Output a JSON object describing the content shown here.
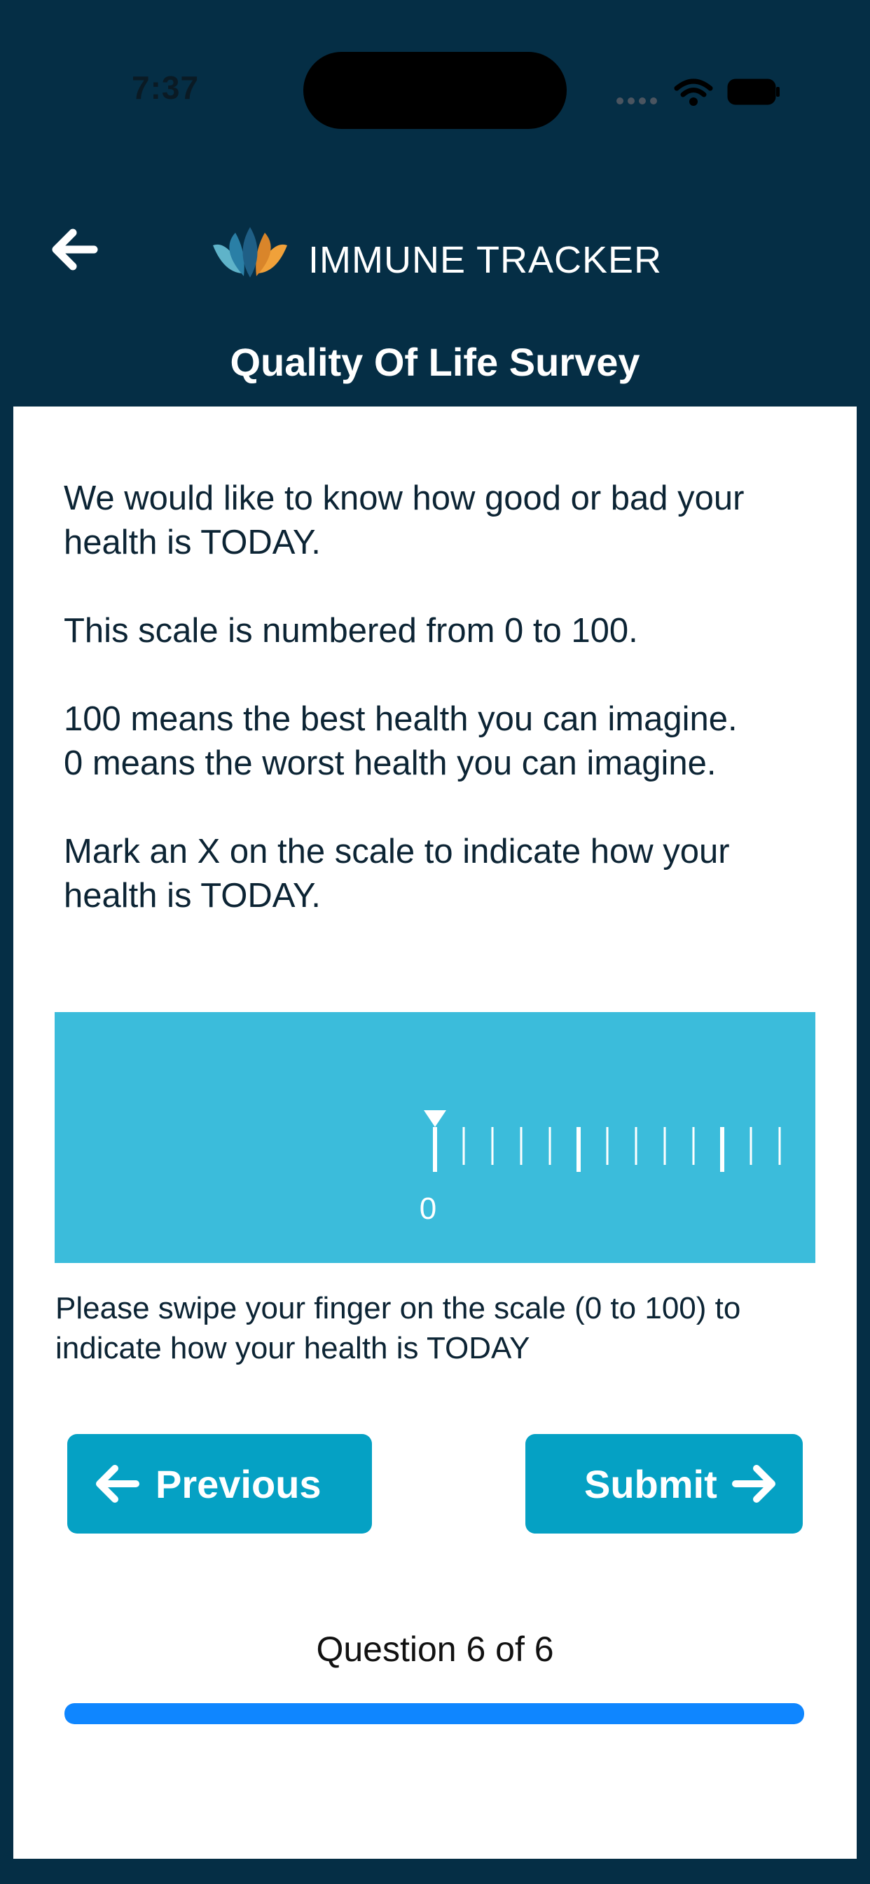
{
  "status_bar": {
    "time": "7:37",
    "icons": [
      "signal-dots-icon",
      "wifi-icon",
      "battery-icon"
    ]
  },
  "header": {
    "back_icon": "arrow-left-icon",
    "logo_icon": "lotus-logo-icon",
    "app_title": "IMMUNE TRACKER",
    "page_title": "Quality Of Life Survey"
  },
  "intro": {
    "p1": "We would like to know how good or bad your health is TODAY.",
    "p2": "This scale is numbered from 0 to 100.",
    "p3a": "100 means the best health you can imagine.",
    "p3b": "0 means the worst health you can imagine.",
    "p4": "Mark an X on the scale to indicate how your health is TODAY."
  },
  "scale": {
    "min": 0,
    "max": 100,
    "current_value": 0,
    "current_label": "0",
    "background_color": "#3bbcdb"
  },
  "instructions": "Please swipe your finger on the scale (0 to 100) to indicate how your health is TODAY",
  "buttons": {
    "previous_label": "Previous",
    "submit_label": "Submit"
  },
  "progress": {
    "label": "Question 6 of 6",
    "current": 6,
    "total": 6,
    "fraction": 1.0,
    "color": "#0f86ff"
  },
  "colors": {
    "header_background": "#052e45",
    "button": "#05a1c4",
    "text": "#0c2434"
  }
}
